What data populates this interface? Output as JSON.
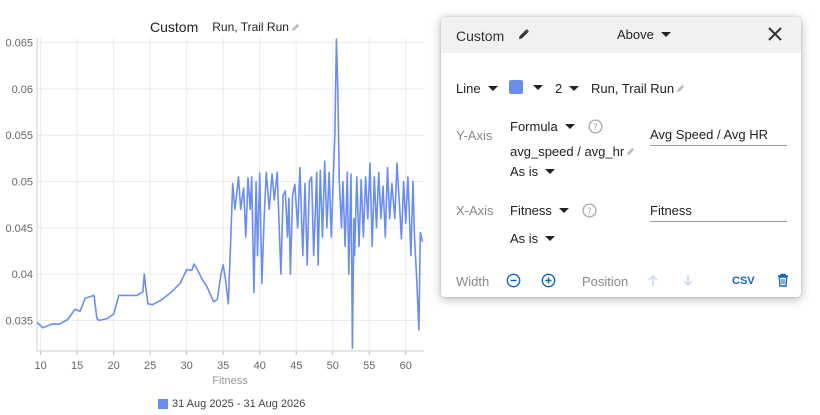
{
  "chart": {
    "title": "Custom",
    "activity": "Run, Trail Run",
    "xlabel": "Fitness",
    "legend_label": "31 Aug 2025 - 31 Aug 2026",
    "line_color": "#6a8eee"
  },
  "chart_data": {
    "type": "line",
    "title": "",
    "xlabel": "Fitness",
    "ylabel": "",
    "xlim": [
      9.5,
      62.5
    ],
    "ylim": [
      0.0317,
      0.0655
    ],
    "xticks": [
      10,
      15,
      20,
      25,
      30,
      35,
      40,
      45,
      50,
      55,
      60
    ],
    "yticks": [
      0.035,
      0.04,
      0.045,
      0.05,
      0.055,
      0.06,
      0.065
    ],
    "grid": true,
    "legend_position": "bottom",
    "series": [
      {
        "name": "31 Aug 2025 - 31 Aug 2026",
        "x": [
          9.5,
          10.3,
          11.5,
          12.6,
          13.7,
          14.7,
          15.4,
          16.1,
          17.3,
          17.7,
          18.0,
          19.1,
          20.0,
          20.7,
          21.7,
          23.2,
          24.0,
          24.2,
          24.4,
          24.7,
          25.3,
          26.5,
          27.8,
          29.1,
          30.0,
          30.7,
          31.0,
          31.6,
          32.0,
          32.8,
          33.7,
          34.2,
          34.7,
          35.0,
          35.3,
          35.7,
          36.0,
          36.3,
          36.6,
          36.9,
          37.1,
          37.4,
          37.8,
          38.1,
          38.4,
          38.7,
          38.9,
          39.2,
          39.5,
          39.7,
          40.0,
          40.3,
          40.6,
          40.9,
          41.3,
          41.7,
          42.0,
          42.4,
          42.9,
          43.2,
          43.5,
          43.8,
          44.0,
          44.2,
          44.5,
          44.8,
          45.2,
          45.5,
          45.9,
          46.2,
          46.5,
          46.8,
          47.1,
          47.4,
          47.8,
          48.0,
          48.3,
          48.6,
          48.9,
          49.2,
          49.5,
          49.8,
          50.1,
          50.3,
          50.5,
          50.7,
          50.9,
          51.2,
          51.4,
          51.7,
          52.0,
          52.2,
          52.5,
          52.7,
          52.9,
          53.0,
          53.3,
          53.6,
          53.9,
          54.2,
          54.5,
          54.8,
          55.1,
          55.4,
          55.7,
          56.0,
          56.3,
          56.6,
          56.9,
          57.2,
          57.5,
          57.8,
          58.1,
          58.5,
          58.8,
          59.1,
          59.4,
          59.7,
          60.0,
          60.3,
          60.7,
          61.0,
          61.2,
          61.5,
          61.8,
          62.0,
          62.3
        ],
        "y": [
          0.0348,
          0.0342,
          0.0346,
          0.0346,
          0.0351,
          0.0362,
          0.036,
          0.0374,
          0.0377,
          0.0352,
          0.035,
          0.0352,
          0.0357,
          0.0377,
          0.0377,
          0.0377,
          0.0381,
          0.04,
          0.0385,
          0.0368,
          0.0367,
          0.0372,
          0.038,
          0.039,
          0.0405,
          0.0404,
          0.0411,
          0.0403,
          0.0396,
          0.0386,
          0.037,
          0.0373,
          0.04,
          0.041,
          0.0395,
          0.0368,
          0.043,
          0.0498,
          0.047,
          0.049,
          0.0505,
          0.047,
          0.0493,
          0.044,
          0.0504,
          0.047,
          0.0505,
          0.038,
          0.05,
          0.042,
          0.0509,
          0.039,
          0.046,
          0.051,
          0.047,
          0.0508,
          0.048,
          0.051,
          0.04,
          0.0485,
          0.049,
          0.044,
          0.0482,
          0.04,
          0.0485,
          0.0497,
          0.045,
          0.0515,
          0.042,
          0.0498,
          0.041,
          0.05,
          0.0505,
          0.042,
          0.051,
          0.041,
          0.0512,
          0.044,
          0.0522,
          0.045,
          0.051,
          0.044,
          0.051,
          0.0552,
          0.0654,
          0.06,
          0.05,
          0.045,
          0.05,
          0.043,
          0.051,
          0.04,
          0.0508,
          0.032,
          0.046,
          0.042,
          0.0505,
          0.043,
          0.0502,
          0.044,
          0.0505,
          0.046,
          0.052,
          0.043,
          0.0505,
          0.045,
          0.051,
          0.046,
          0.0495,
          0.044,
          0.0515,
          0.046,
          0.0498,
          0.046,
          0.052,
          0.048,
          0.0438,
          0.05,
          0.0455,
          0.0505,
          0.042,
          0.05,
          0.044,
          0.0395,
          0.034,
          0.0445,
          0.0435
        ]
      }
    ]
  },
  "panel": {
    "title": "Custom",
    "position_select": "Above",
    "type_select": "Line",
    "line_width_select": "2",
    "activity": "Run, Trail Run",
    "y_axis": {
      "label": "Y-Axis",
      "source_select": "Formula",
      "formula": "avg_speed / avg_hr",
      "transform_select": "As is",
      "title_value": "Avg Speed / Avg HR"
    },
    "x_axis": {
      "label": "X-Axis",
      "source_select": "Fitness",
      "transform_select": "As is",
      "title_value": "Fitness"
    },
    "width_label": "Width",
    "position_label": "Position",
    "csv_label": "CSV",
    "accent_color": "#1565c0",
    "series_color": "#6a8eee"
  }
}
